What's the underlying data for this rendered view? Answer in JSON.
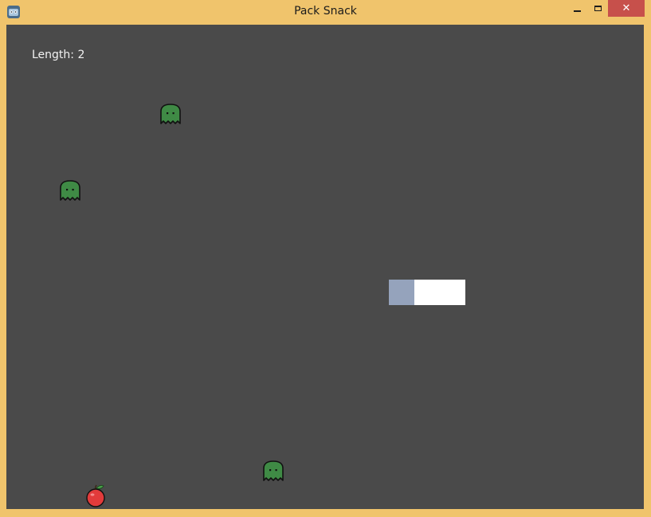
{
  "window": {
    "title": "Pack Snack",
    "close_glyph": "✕"
  },
  "hud": {
    "length_label": "Length: 2"
  },
  "colors": {
    "frame": "#f0c46c",
    "background": "#4a4a4a",
    "ghost": "#3f8a45",
    "snake_head": "#95a3bc",
    "snake_body": "#ffffff",
    "apple": "#e23b3b",
    "close_button": "#c7504b"
  },
  "entities": {
    "ghosts": [
      {
        "icon": "ghost-icon"
      },
      {
        "icon": "ghost-icon"
      },
      {
        "icon": "ghost-icon"
      }
    ],
    "snake": {
      "length": 2
    },
    "food": {
      "icon": "apple-icon"
    }
  }
}
